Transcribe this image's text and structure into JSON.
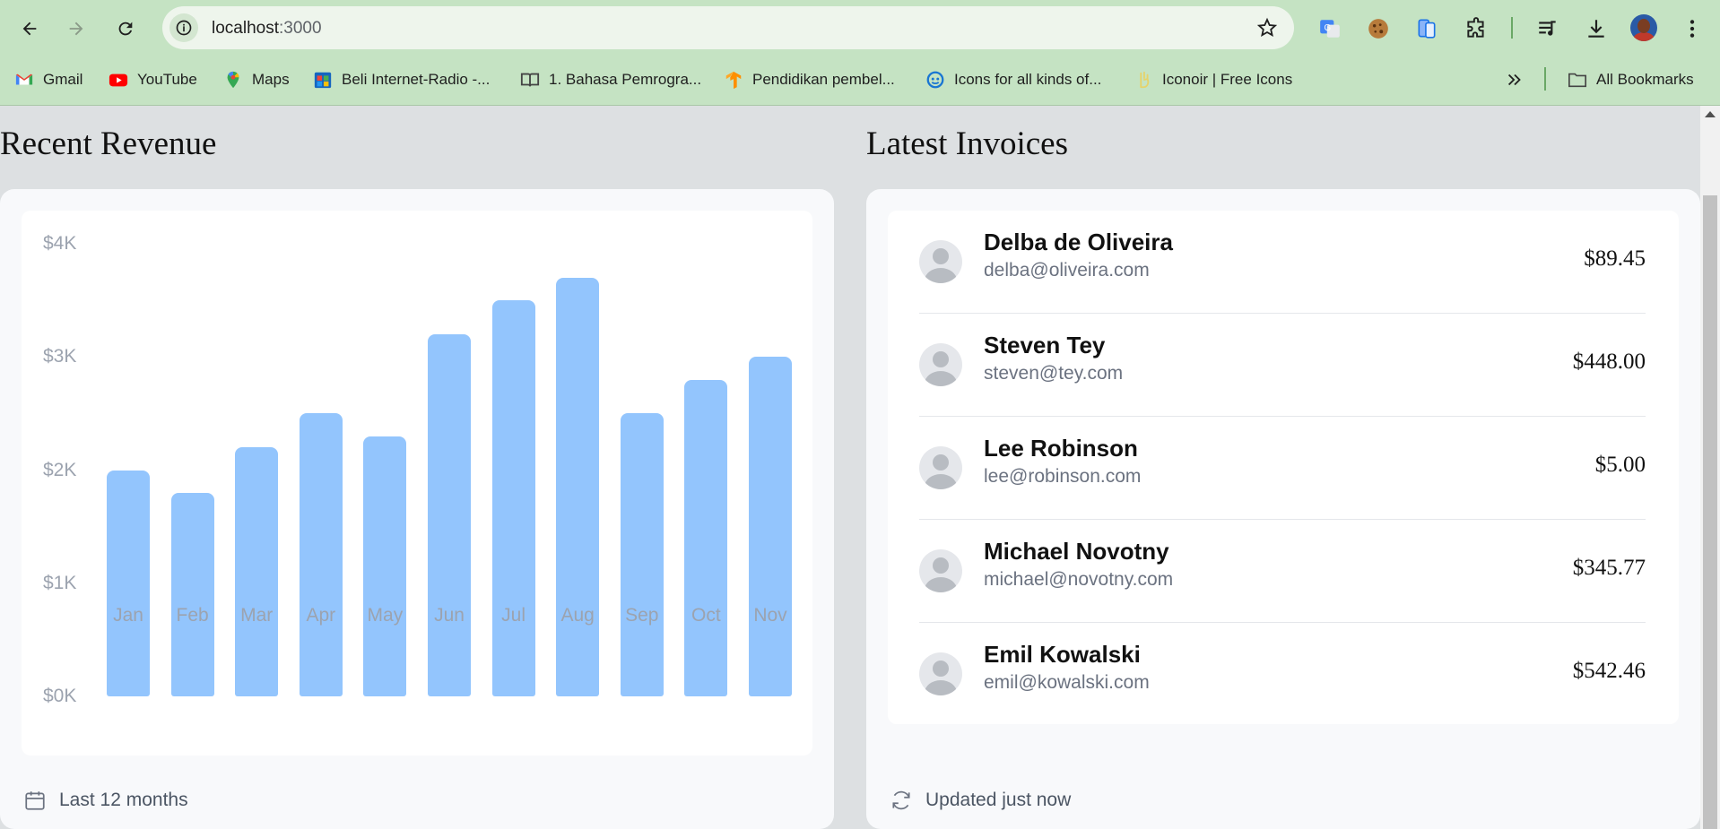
{
  "browser": {
    "url_host": "localhost",
    "url_port": ":3000",
    "bookmarks": [
      {
        "label": "Gmail",
        "icon": "gmail-icon"
      },
      {
        "label": "YouTube",
        "icon": "youtube-icon"
      },
      {
        "label": "Maps",
        "icon": "maps-icon"
      },
      {
        "label": "Beli Internet-Radio -...",
        "icon": "store-icon"
      },
      {
        "label": "1. Bahasa Pemrogra...",
        "icon": "book-icon"
      },
      {
        "label": "Pendidikan pembel...",
        "icon": "tensorflow-icon"
      },
      {
        "label": "Icons for all kinds of...",
        "icon": "icons-site-icon"
      },
      {
        "label": "Iconoir | Free Icons",
        "icon": "iconoir-icon"
      }
    ],
    "all_bookmarks_label": "All Bookmarks"
  },
  "revenue": {
    "title": "Recent Revenue",
    "footer": "Last 12 months"
  },
  "chart_data": {
    "type": "bar",
    "title": "",
    "xlabel": "",
    "ylabel": "",
    "ylim": [
      0,
      4000
    ],
    "y_ticks": [
      "$4K",
      "$3K",
      "$2K",
      "$1K",
      "$0K"
    ],
    "categories": [
      "Jan",
      "Feb",
      "Mar",
      "Apr",
      "May",
      "Jun",
      "Jul",
      "Aug",
      "Sep",
      "Oct",
      "Nov"
    ],
    "values": [
      2000,
      1800,
      2200,
      2500,
      2300,
      3200,
      3500,
      3700,
      2500,
      2800,
      3000
    ],
    "grid": false,
    "color": "#93c5fd"
  },
  "invoices": {
    "title": "Latest Invoices",
    "footer": "Updated just now",
    "items": [
      {
        "name": "Delba de Oliveira",
        "email": "delba@oliveira.com",
        "amount": "$89.45"
      },
      {
        "name": "Steven Tey",
        "email": "steven@tey.com",
        "amount": "$448.00"
      },
      {
        "name": "Lee Robinson",
        "email": "lee@robinson.com",
        "amount": "$5.00"
      },
      {
        "name": "Michael Novotny",
        "email": "michael@novotny.com",
        "amount": "$345.77"
      },
      {
        "name": "Emil Kowalski",
        "email": "emil@kowalski.com",
        "amount": "$542.46"
      }
    ]
  }
}
